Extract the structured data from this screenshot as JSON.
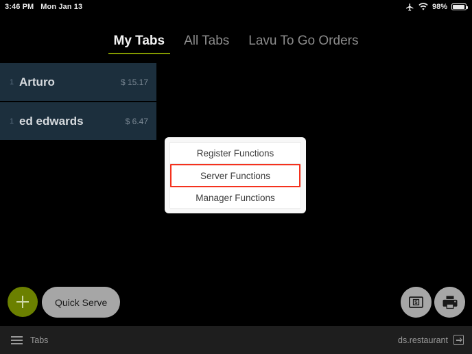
{
  "status_bar": {
    "time": "3:46 PM",
    "date": "Mon Jan 13",
    "airplane_icon": "airplane-icon",
    "wifi_icon": "wifi-icon",
    "battery_percent": "98%",
    "battery_icon": "battery-icon"
  },
  "tab_bar": {
    "tabs": [
      {
        "label": "My Tabs",
        "active": true
      },
      {
        "label": "All Tabs",
        "active": false
      },
      {
        "label": "Lavu To Go Orders",
        "active": false
      }
    ],
    "active_underline_color": "#849a00"
  },
  "tab_list": {
    "rows": [
      {
        "qty": "1",
        "name": "Arturo",
        "amount": "$ 15.17"
      },
      {
        "qty": "1",
        "name": "ed edwards",
        "amount": "$ 6.47"
      }
    ],
    "row_background": "#1c2f3d"
  },
  "modal": {
    "items": [
      {
        "label": "Register Functions",
        "highlighted": false
      },
      {
        "label": "Server Functions",
        "highlighted": true
      },
      {
        "label": "Manager Functions",
        "highlighted": false
      }
    ],
    "highlight_color": "#f4321e"
  },
  "actions": {
    "add_label": "",
    "add_icon": "plus-icon",
    "quick_serve_label": "Quick Serve",
    "cash_drawer_icon": "cash-drawer-icon",
    "print_icon": "printer-icon",
    "accent_color": "#6b8000"
  },
  "bottom_bar": {
    "menu_icon": "hamburger-menu-icon",
    "menu_label": "Tabs",
    "account_label": "ds.restaurant",
    "logout_icon": "logout-icon"
  }
}
